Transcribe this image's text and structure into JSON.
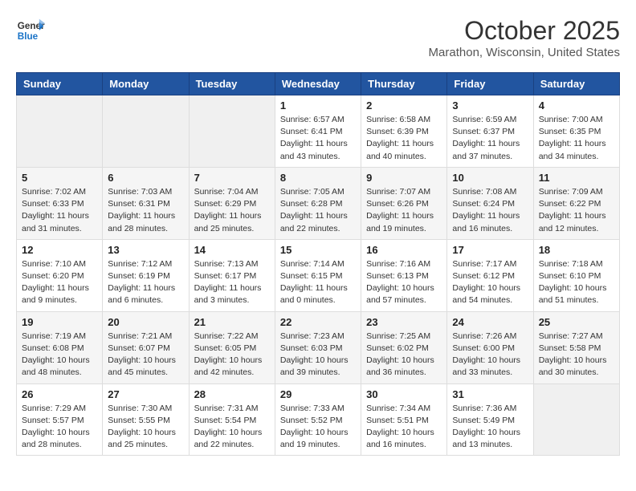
{
  "header": {
    "logo_line1": "General",
    "logo_line2": "Blue",
    "month": "October 2025",
    "location": "Marathon, Wisconsin, United States"
  },
  "weekdays": [
    "Sunday",
    "Monday",
    "Tuesday",
    "Wednesday",
    "Thursday",
    "Friday",
    "Saturday"
  ],
  "weeks": [
    [
      {
        "day": "",
        "info": ""
      },
      {
        "day": "",
        "info": ""
      },
      {
        "day": "",
        "info": ""
      },
      {
        "day": "1",
        "info": "Sunrise: 6:57 AM\nSunset: 6:41 PM\nDaylight: 11 hours\nand 43 minutes."
      },
      {
        "day": "2",
        "info": "Sunrise: 6:58 AM\nSunset: 6:39 PM\nDaylight: 11 hours\nand 40 minutes."
      },
      {
        "day": "3",
        "info": "Sunrise: 6:59 AM\nSunset: 6:37 PM\nDaylight: 11 hours\nand 37 minutes."
      },
      {
        "day": "4",
        "info": "Sunrise: 7:00 AM\nSunset: 6:35 PM\nDaylight: 11 hours\nand 34 minutes."
      }
    ],
    [
      {
        "day": "5",
        "info": "Sunrise: 7:02 AM\nSunset: 6:33 PM\nDaylight: 11 hours\nand 31 minutes."
      },
      {
        "day": "6",
        "info": "Sunrise: 7:03 AM\nSunset: 6:31 PM\nDaylight: 11 hours\nand 28 minutes."
      },
      {
        "day": "7",
        "info": "Sunrise: 7:04 AM\nSunset: 6:29 PM\nDaylight: 11 hours\nand 25 minutes."
      },
      {
        "day": "8",
        "info": "Sunrise: 7:05 AM\nSunset: 6:28 PM\nDaylight: 11 hours\nand 22 minutes."
      },
      {
        "day": "9",
        "info": "Sunrise: 7:07 AM\nSunset: 6:26 PM\nDaylight: 11 hours\nand 19 minutes."
      },
      {
        "day": "10",
        "info": "Sunrise: 7:08 AM\nSunset: 6:24 PM\nDaylight: 11 hours\nand 16 minutes."
      },
      {
        "day": "11",
        "info": "Sunrise: 7:09 AM\nSunset: 6:22 PM\nDaylight: 11 hours\nand 12 minutes."
      }
    ],
    [
      {
        "day": "12",
        "info": "Sunrise: 7:10 AM\nSunset: 6:20 PM\nDaylight: 11 hours\nand 9 minutes."
      },
      {
        "day": "13",
        "info": "Sunrise: 7:12 AM\nSunset: 6:19 PM\nDaylight: 11 hours\nand 6 minutes."
      },
      {
        "day": "14",
        "info": "Sunrise: 7:13 AM\nSunset: 6:17 PM\nDaylight: 11 hours\nand 3 minutes."
      },
      {
        "day": "15",
        "info": "Sunrise: 7:14 AM\nSunset: 6:15 PM\nDaylight: 11 hours\nand 0 minutes."
      },
      {
        "day": "16",
        "info": "Sunrise: 7:16 AM\nSunset: 6:13 PM\nDaylight: 10 hours\nand 57 minutes."
      },
      {
        "day": "17",
        "info": "Sunrise: 7:17 AM\nSunset: 6:12 PM\nDaylight: 10 hours\nand 54 minutes."
      },
      {
        "day": "18",
        "info": "Sunrise: 7:18 AM\nSunset: 6:10 PM\nDaylight: 10 hours\nand 51 minutes."
      }
    ],
    [
      {
        "day": "19",
        "info": "Sunrise: 7:19 AM\nSunset: 6:08 PM\nDaylight: 10 hours\nand 48 minutes."
      },
      {
        "day": "20",
        "info": "Sunrise: 7:21 AM\nSunset: 6:07 PM\nDaylight: 10 hours\nand 45 minutes."
      },
      {
        "day": "21",
        "info": "Sunrise: 7:22 AM\nSunset: 6:05 PM\nDaylight: 10 hours\nand 42 minutes."
      },
      {
        "day": "22",
        "info": "Sunrise: 7:23 AM\nSunset: 6:03 PM\nDaylight: 10 hours\nand 39 minutes."
      },
      {
        "day": "23",
        "info": "Sunrise: 7:25 AM\nSunset: 6:02 PM\nDaylight: 10 hours\nand 36 minutes."
      },
      {
        "day": "24",
        "info": "Sunrise: 7:26 AM\nSunset: 6:00 PM\nDaylight: 10 hours\nand 33 minutes."
      },
      {
        "day": "25",
        "info": "Sunrise: 7:27 AM\nSunset: 5:58 PM\nDaylight: 10 hours\nand 30 minutes."
      }
    ],
    [
      {
        "day": "26",
        "info": "Sunrise: 7:29 AM\nSunset: 5:57 PM\nDaylight: 10 hours\nand 28 minutes."
      },
      {
        "day": "27",
        "info": "Sunrise: 7:30 AM\nSunset: 5:55 PM\nDaylight: 10 hours\nand 25 minutes."
      },
      {
        "day": "28",
        "info": "Sunrise: 7:31 AM\nSunset: 5:54 PM\nDaylight: 10 hours\nand 22 minutes."
      },
      {
        "day": "29",
        "info": "Sunrise: 7:33 AM\nSunset: 5:52 PM\nDaylight: 10 hours\nand 19 minutes."
      },
      {
        "day": "30",
        "info": "Sunrise: 7:34 AM\nSunset: 5:51 PM\nDaylight: 10 hours\nand 16 minutes."
      },
      {
        "day": "31",
        "info": "Sunrise: 7:36 AM\nSunset: 5:49 PM\nDaylight: 10 hours\nand 13 minutes."
      },
      {
        "day": "",
        "info": ""
      }
    ]
  ]
}
